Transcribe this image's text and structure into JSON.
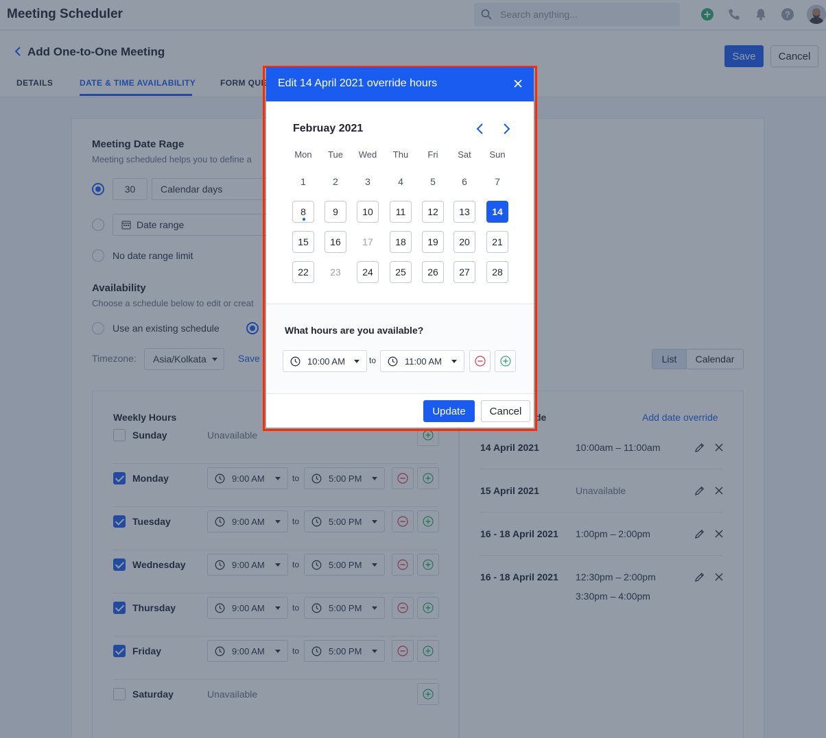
{
  "app": {
    "title": "Meeting Scheduler"
  },
  "search": {
    "placeholder": "Search anything..."
  },
  "header": {
    "title": "Add One-to-One Meeting",
    "save_label": "Save",
    "cancel_label": "Cancel",
    "tabs": [
      {
        "label": "DETAILS"
      },
      {
        "label": "DATE & TIME AVAILABILITY"
      },
      {
        "label": "FORM QUE"
      }
    ]
  },
  "date_range": {
    "title": "Meeting Date Rage",
    "desc": "Meeting scheduled helps you to define a",
    "days_value": "30",
    "days_unit": "Calendar days",
    "date_range_label": "Date range",
    "no_limit_label": "No date range limit"
  },
  "availability": {
    "title": "Availability",
    "desc": "Choose a schedule below to edit or creat",
    "use_existing_label": "Use an existing schedule",
    "timezone_label": "Timezone:",
    "timezone_value": "Asia/Kolkata",
    "save_link": "Save",
    "view_list": "List",
    "view_calendar": "Calendar"
  },
  "weekly": {
    "title": "Weekly Hours",
    "to_label": "to",
    "unavailable_label": "Unavailable",
    "days": [
      {
        "name": "Sunday",
        "checked": false,
        "start": "",
        "end": ""
      },
      {
        "name": "Monday",
        "checked": true,
        "start": "9:00 AM",
        "end": "5:00 PM"
      },
      {
        "name": "Tuesday",
        "checked": true,
        "start": "9:00 AM",
        "end": "5:00 PM"
      },
      {
        "name": "Wednesday",
        "checked": true,
        "start": "9:00 AM",
        "end": "5:00 PM"
      },
      {
        "name": "Thursday",
        "checked": true,
        "start": "9:00 AM",
        "end": "5:00 PM"
      },
      {
        "name": "Friday",
        "checked": true,
        "start": "9:00 AM",
        "end": "5:00 PM"
      },
      {
        "name": "Saturday",
        "checked": false,
        "start": "",
        "end": ""
      }
    ]
  },
  "overrides": {
    "title_fragment": "de",
    "add_link": "Add date override",
    "items": [
      {
        "date": "14 April 2021",
        "times": [
          "10:00am – 11:00am"
        ],
        "unavailable": false
      },
      {
        "date": "15 April 2021",
        "times": [
          "Unavailable"
        ],
        "unavailable": true
      },
      {
        "date": "16 - 18 April 2021",
        "times": [
          "1:00pm – 2:00pm"
        ],
        "unavailable": false
      },
      {
        "date": "16 - 18 April 2021",
        "times": [
          "12:30pm – 2:00pm",
          "3:30pm – 4:00pm"
        ],
        "unavailable": false
      }
    ]
  },
  "modal": {
    "title": "Edit 14 April 2021 override hours",
    "month_label": "Februay 2021",
    "weekdays": [
      "Mon",
      "Tue",
      "Wed",
      "Thu",
      "Fri",
      "Sat",
      "Sun"
    ],
    "weeks": [
      [
        {
          "d": "1",
          "s": "plain"
        },
        {
          "d": "2",
          "s": "plain"
        },
        {
          "d": "3",
          "s": "plain"
        },
        {
          "d": "4",
          "s": "plain"
        },
        {
          "d": "5",
          "s": "plain"
        },
        {
          "d": "6",
          "s": "plain"
        },
        {
          "d": "7",
          "s": "plain"
        }
      ],
      [
        {
          "d": "8",
          "s": "avail",
          "dot": true
        },
        {
          "d": "9",
          "s": "avail"
        },
        {
          "d": "10",
          "s": "avail"
        },
        {
          "d": "11",
          "s": "avail"
        },
        {
          "d": "12",
          "s": "avail"
        },
        {
          "d": "13",
          "s": "avail"
        },
        {
          "d": "14",
          "s": "sel"
        }
      ],
      [
        {
          "d": "15",
          "s": "avail"
        },
        {
          "d": "16",
          "s": "avail"
        },
        {
          "d": "17",
          "s": "muted"
        },
        {
          "d": "18",
          "s": "avail"
        },
        {
          "d": "19",
          "s": "avail"
        },
        {
          "d": "20",
          "s": "avail"
        },
        {
          "d": "21",
          "s": "avail"
        }
      ],
      [
        {
          "d": "22",
          "s": "avail"
        },
        {
          "d": "23",
          "s": "muted"
        },
        {
          "d": "24",
          "s": "avail"
        },
        {
          "d": "25",
          "s": "avail"
        },
        {
          "d": "26",
          "s": "avail"
        },
        {
          "d": "27",
          "s": "avail"
        },
        {
          "d": "28",
          "s": "avail"
        }
      ]
    ],
    "hours_question": "What hours are you available?",
    "start_time": "10:00 AM",
    "to_label": "to",
    "end_time": "11:00 AM",
    "update_label": "Update",
    "cancel_label": "Cancel"
  },
  "colors": {
    "primary": "#1a5cf0",
    "danger": "#e0384b",
    "success": "#2eae6b",
    "highlight_outline": "#ff2a00"
  }
}
